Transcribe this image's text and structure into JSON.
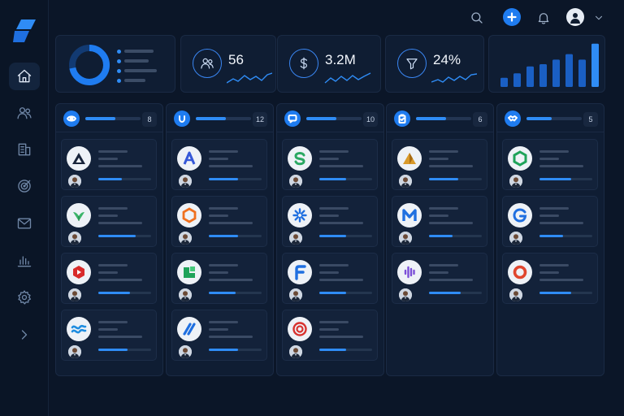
{
  "app": {
    "logo": "brand-logo"
  },
  "sidebar": {
    "items": [
      {
        "name": "home",
        "icon": "home-icon",
        "active": true
      },
      {
        "name": "contacts",
        "icon": "users-icon",
        "active": false
      },
      {
        "name": "companies",
        "icon": "building-icon",
        "active": false
      },
      {
        "name": "goals",
        "icon": "target-icon",
        "active": false
      },
      {
        "name": "mail",
        "icon": "mail-icon",
        "active": false
      },
      {
        "name": "reports",
        "icon": "chart-icon",
        "active": false
      },
      {
        "name": "settings",
        "icon": "gear-icon",
        "active": false
      },
      {
        "name": "expand",
        "icon": "chevron-right-icon",
        "active": false
      }
    ]
  },
  "topbar": {
    "icons": [
      "search-icon",
      "plus-icon",
      "bell-icon",
      "user-avatar-icon",
      "chevron-down-icon"
    ]
  },
  "stats": {
    "contacts": {
      "value": "56",
      "icon": "users-icon"
    },
    "revenue": {
      "value": "3.2M",
      "icon": "dollar-icon"
    },
    "conversion": {
      "value": "24%",
      "icon": "funnel-icon"
    }
  },
  "donut": {
    "fraction": 0.72
  },
  "bar_chart": {
    "values": [
      0.2,
      0.3,
      0.45,
      0.5,
      0.6,
      0.72,
      0.6,
      0.95
    ]
  },
  "colors": {
    "accent": "#1f7cf0",
    "background": "#0b1628",
    "panel": "#0f1d33"
  },
  "columns": [
    {
      "icon": "eye-icon",
      "count": "8",
      "progress": 0.55,
      "cards": [
        {
          "logo": "triangle-logo",
          "progress": 0.45
        },
        {
          "logo": "leaf-logo",
          "progress": 0.7
        },
        {
          "logo": "hexagon-red-logo",
          "progress": 0.6
        },
        {
          "logo": "wave-logo",
          "progress": 0.55
        }
      ]
    },
    {
      "icon": "magnet-icon",
      "count": "12",
      "progress": 0.55,
      "cards": [
        {
          "logo": "letter-a-logo",
          "progress": 0.55
        },
        {
          "logo": "hexagon-orange-logo",
          "progress": 0.55
        },
        {
          "logo": "green-block-logo",
          "progress": 0.5
        },
        {
          "logo": "stripes-logo",
          "progress": 0.55
        }
      ]
    },
    {
      "icon": "chat-icon",
      "count": "10",
      "progress": 0.55,
      "cards": [
        {
          "logo": "letter-s-logo",
          "progress": 0.5
        },
        {
          "logo": "asterisk-logo",
          "progress": 0.5
        },
        {
          "logo": "letter-f-logo",
          "progress": 0.5
        },
        {
          "logo": "target-logo",
          "progress": 0.5
        }
      ]
    },
    {
      "icon": "clipboard-icon",
      "count": "6",
      "progress": 0.55,
      "cards": [
        {
          "logo": "mountain-logo",
          "progress": 0.55
        },
        {
          "logo": "letter-m-logo",
          "progress": 0.45
        },
        {
          "logo": "bars-logo",
          "progress": 0.6
        }
      ]
    },
    {
      "icon": "handshake-icon",
      "count": "5",
      "progress": 0.45,
      "cards": [
        {
          "logo": "hexagon-green-logo",
          "progress": 0.6
        },
        {
          "logo": "letter-g-logo",
          "progress": 0.45
        },
        {
          "logo": "ring-logo",
          "progress": 0.6
        }
      ]
    }
  ]
}
